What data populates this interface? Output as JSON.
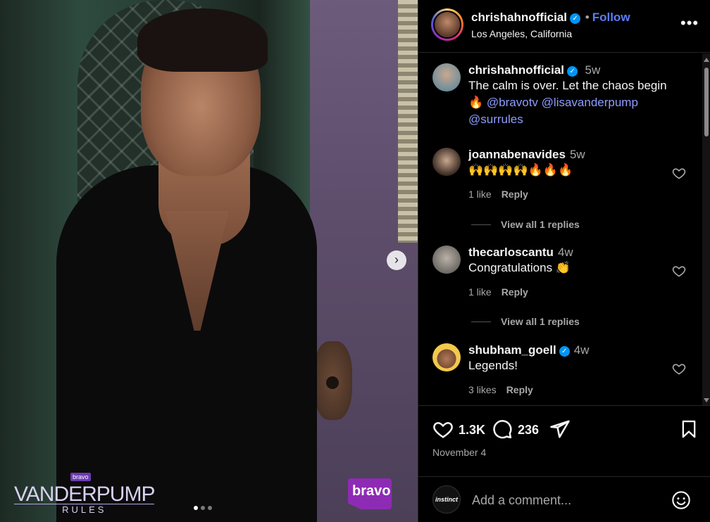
{
  "media": {
    "show_logo_top": "bravo",
    "show_logo_title": "VANDERPUMP",
    "show_logo_sub": "RULES",
    "network_logo": "bravo",
    "carousel": {
      "current": 1,
      "total": 3
    },
    "next_icon": "chevron-right-icon"
  },
  "header": {
    "username": "chrishahnofficial",
    "separator": "•",
    "follow_label": "Follow",
    "location": "Los Angeles, California",
    "more_icon": "more-horizontal-icon"
  },
  "caption": {
    "username": "chrishahnofficial",
    "time": "5w",
    "text": "The calm is over. Let the chaos begin 🔥",
    "mentions": [
      "@bravotv",
      "@lisavanderpump",
      "@surrules"
    ]
  },
  "comments": [
    {
      "username": "joannabenavides",
      "time": "5w",
      "text": "🙌🙌🙌🙌🔥🔥🔥",
      "likes": "1 like",
      "reply_label": "Reply",
      "view_replies": "View all 1 replies",
      "verified": false
    },
    {
      "username": "thecarloscantu",
      "time": "4w",
      "text": "Congratulations 👏",
      "likes": "1 like",
      "reply_label": "Reply",
      "view_replies": "View all 1 replies",
      "verified": false
    },
    {
      "username": "shubham_goell",
      "time": "4w",
      "text": "Legends!",
      "likes": "3 likes",
      "reply_label": "Reply",
      "verified": true
    }
  ],
  "actions": {
    "likes_count": "1.3K",
    "comments_count": "236",
    "date": "November 4"
  },
  "add_comment": {
    "placeholder": "Add a comment...",
    "avatar_text": "instinct"
  },
  "colors": {
    "accent": "#5c7cfa",
    "mention": "#8e9cff",
    "verified": "#0095f6",
    "muted": "#a8a8a8"
  }
}
